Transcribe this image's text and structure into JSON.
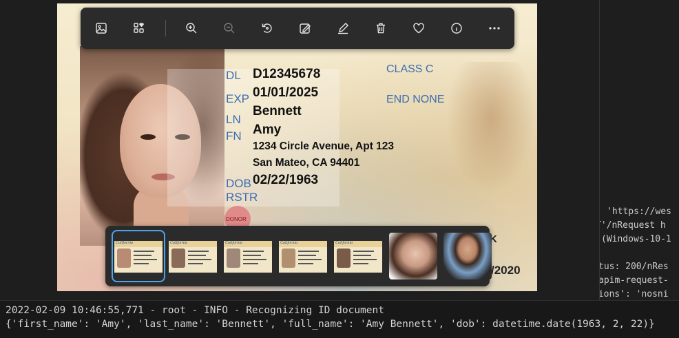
{
  "viewer": {
    "toolbar": [
      {
        "id": "image",
        "icon": "image-icon"
      },
      {
        "id": "collection",
        "icon": "add-to-album-icon"
      },
      {
        "id": "zoom-in",
        "icon": "zoom-in-icon"
      },
      {
        "id": "zoom-out",
        "icon": "zoom-out-icon"
      },
      {
        "id": "rotate",
        "icon": "rotate-icon"
      },
      {
        "id": "edit",
        "icon": "edit-image-icon"
      },
      {
        "id": "draw",
        "icon": "draw-icon"
      },
      {
        "id": "delete",
        "icon": "delete-icon"
      },
      {
        "id": "favorite",
        "icon": "heart-icon"
      },
      {
        "id": "info",
        "icon": "info-icon"
      },
      {
        "id": "more",
        "icon": "more-icon"
      }
    ],
    "card": {
      "dl_label": "DL",
      "dl": "D12345678",
      "exp_label": "EXP",
      "exp": "01/01/2025",
      "ln_label": "LN",
      "ln": "Bennett",
      "fn_label": "FN",
      "fn": "Amy",
      "address1": "1234 Circle Avenue, Apt 123",
      "address2": "San Mateo, CA 94401",
      "dob_label": "DOB",
      "dob": "02/22/1963",
      "rstr_label": "RSTR",
      "class_text": "CLASS C",
      "end_text": "END NONE",
      "donor": "DONOR",
      "k_tail": "K",
      "exp_tail": "/2020"
    },
    "thumbnails": [
      {
        "kind": "card",
        "face": "#b98a74",
        "selected": true
      },
      {
        "kind": "card",
        "face": "#8a6a58",
        "selected": false
      },
      {
        "kind": "card",
        "face": "#a08878",
        "selected": false
      },
      {
        "kind": "card",
        "face": "#b0906f",
        "selected": false
      },
      {
        "kind": "card",
        "face": "#7a5a48",
        "selected": false
      },
      {
        "kind": "photo",
        "tone": "#c89a84",
        "selected": false
      },
      {
        "kind": "photo",
        "tone": "#7aa0c8",
        "selected": false
      }
    ],
    "card_brand": "California"
  },
  "right_panel": {
    "lines": [
      "'https://wes",
      "T'/nRequest h",
      "(Windows-10-1",
      "tus: 200/nRes",
      "apim-request-",
      "tions': 'nosni"
    ]
  },
  "terminal": {
    "line1": "2022-02-09 10:46:55,771 - root - INFO - Recognizing ID document",
    "line2": "{'first_name': 'Amy', 'last_name': 'Bennett', 'full_name': 'Amy Bennett', 'dob': datetime.date(1963, 2, 22)}"
  }
}
